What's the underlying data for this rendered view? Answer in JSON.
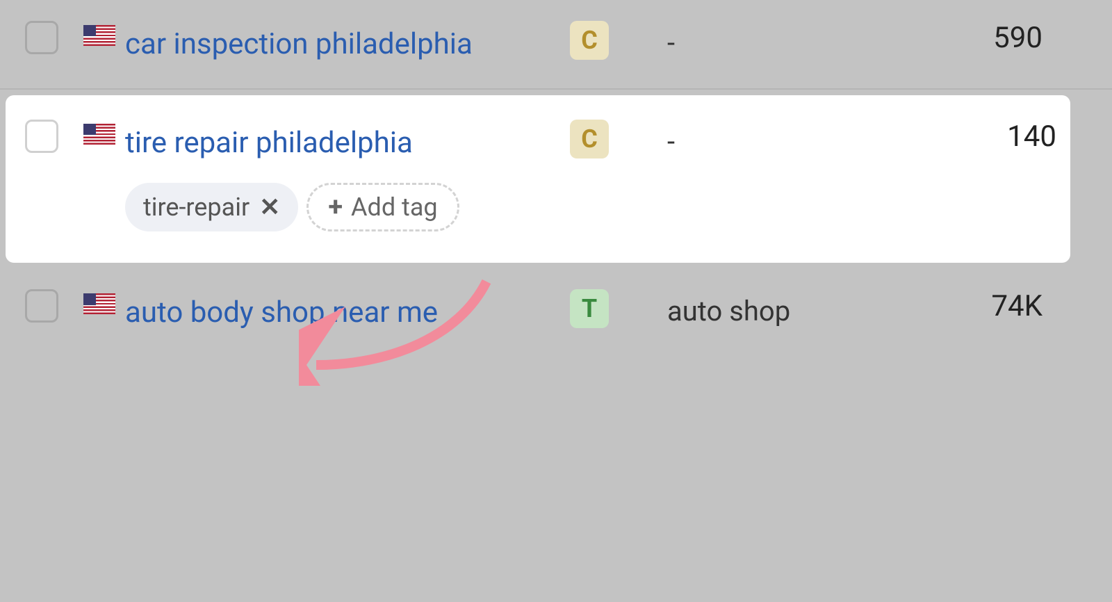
{
  "rows": [
    {
      "keyword": "car inspection philadelphia",
      "badge": "C",
      "badge_class": "badge-c",
      "tags_text": "-",
      "volume": "590",
      "highlight": false
    },
    {
      "keyword": "tire repair philadelphia",
      "badge": "C",
      "badge_class": "badge-c",
      "tags_text": "-",
      "volume": "140",
      "highlight": true,
      "existing_tag": "tire-repair",
      "add_tag_label": "Add tag"
    },
    {
      "keyword": "auto body shop near me",
      "badge": "T",
      "badge_class": "badge-t",
      "tags_text": "auto shop",
      "volume": "74K",
      "highlight": false
    }
  ]
}
